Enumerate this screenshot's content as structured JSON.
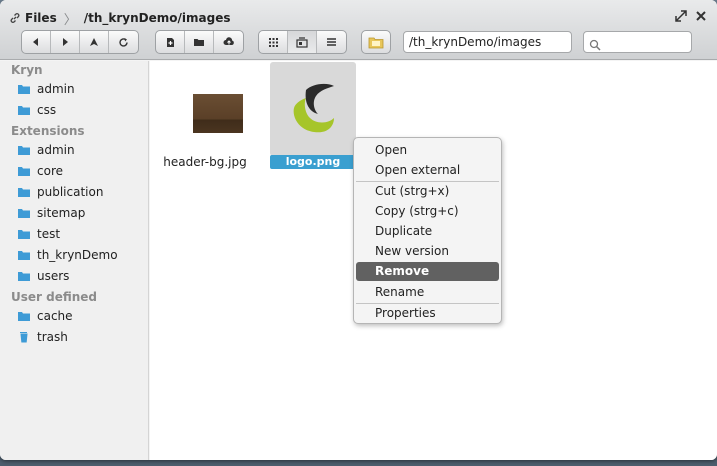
{
  "window": {
    "app_title": "Files",
    "path_title": "/th_krynDemo/images"
  },
  "toolbar": {
    "nav": [
      "back-icon",
      "forward-icon",
      "up-icon",
      "refresh-icon"
    ],
    "actions": [
      "new-file-icon",
      "new-folder-icon",
      "upload-icon"
    ],
    "views": [
      "icon-view-icon",
      "detail-view-icon",
      "list-view-icon"
    ],
    "path_value": "/th_krynDemo/images",
    "search_value": ""
  },
  "sidebar": {
    "sections": [
      {
        "title": "Kryn",
        "items": [
          "admin",
          "css"
        ]
      },
      {
        "title": "Extensions",
        "items": [
          "admin",
          "core",
          "publication",
          "sitemap",
          "test",
          "th_krynDemo",
          "users"
        ]
      },
      {
        "title": "User defined",
        "items": [
          "cache",
          "trash"
        ]
      }
    ]
  },
  "files": [
    {
      "name": "header-bg.jpg",
      "selected": false
    },
    {
      "name": "logo.png",
      "selected": true
    }
  ],
  "context_menu": {
    "items": [
      {
        "label": "Open"
      },
      {
        "label": "Open external"
      },
      {
        "label": "Cut (strg+x)"
      },
      {
        "label": "Copy (strg+c)"
      },
      {
        "label": "Duplicate"
      },
      {
        "label": "New version"
      },
      {
        "label": "Remove",
        "highlighted": true
      },
      {
        "label": "Rename"
      },
      {
        "label": "Properties"
      }
    ]
  },
  "colors": {
    "selection_blue": "#3a9fd0",
    "folder_blue": "#3e9bd6",
    "menu_highlight": "#616161",
    "logo_green": "#a6c52a"
  }
}
